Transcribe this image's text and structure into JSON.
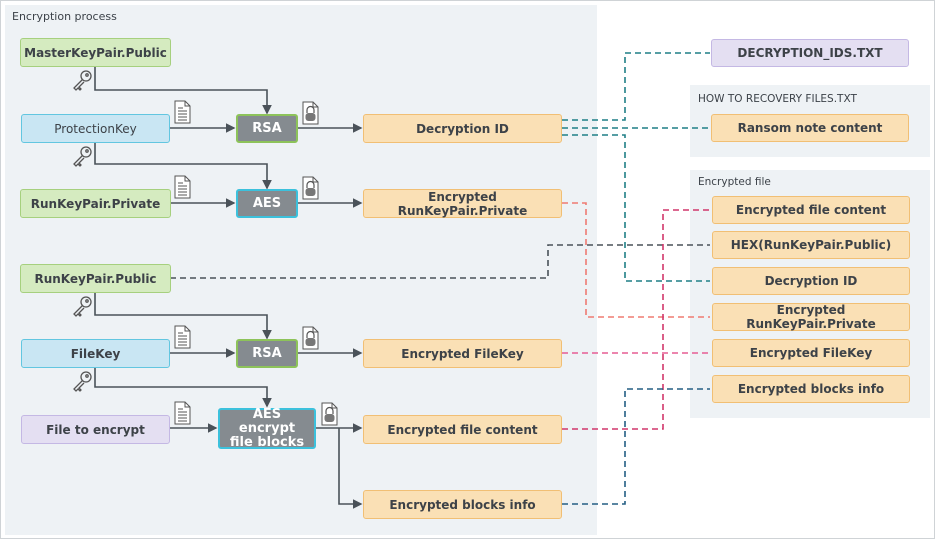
{
  "panels": {
    "encryption_process": "Encryption process",
    "ransom_note_file": "HOW TO RECOVERY FILES.TXT",
    "encrypted_file": "Encrypted file"
  },
  "inputs": {
    "master_public": "MasterKeyPair.Public",
    "protection_key": "ProtectionKey",
    "run_private": "RunKeyPair.Private",
    "run_public": "RunKeyPair.Public",
    "file_key": "FileKey",
    "file_to_encrypt": "File to encrypt"
  },
  "algorithms": {
    "rsa1": "RSA",
    "aes": "AES",
    "rsa2": "RSA",
    "aes_blocks": "AES encrypt file blocks"
  },
  "outputs": {
    "decryption_id": "Decryption ID",
    "enc_run_private": "Encrypted RunKeyPair.Private",
    "enc_file_key": "Encrypted FileKey",
    "enc_file_content": "Encrypted file content",
    "enc_blocks_info": "Encrypted blocks info"
  },
  "artifacts": {
    "decryption_ids_file": "DECRYPTION_IDS.TXT",
    "ransom_note_content": "Ransom note content"
  },
  "encrypted_file_parts": [
    "Encrypted file content",
    "HEX(RunKeyPair.Public)",
    "Decryption ID",
    "Encrypted RunKeyPair.Private",
    "Encrypted FileKey",
    "Encrypted blocks info"
  ],
  "colors": {
    "teal_link": "#1f7f86",
    "dark_link": "#4a5259",
    "salmon_link": "#ef7b72",
    "crimson_link": "#d1366b",
    "pink_link": "#e65d93",
    "navy_link": "#235e84"
  },
  "icons": {
    "key": "key-icon",
    "document": "document-icon",
    "locked_document": "locked-document-icon"
  }
}
